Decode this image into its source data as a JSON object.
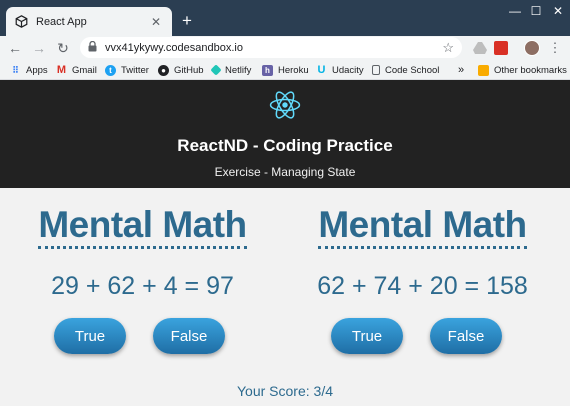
{
  "browser": {
    "tab_title": "React App",
    "url": "vvx41ykywy.codesandbox.io",
    "bookmarks": [
      "Apps",
      "Gmail",
      "Twitter",
      "GitHub",
      "Netlify",
      "Heroku",
      "Udacity",
      "Code School"
    ],
    "overflow": "»",
    "other_bookmarks": "Other bookmarks"
  },
  "header": {
    "title": "ReactND - Coding Practice",
    "subtitle": "Exercise - Managing State"
  },
  "games": [
    {
      "heading": "Mental Math",
      "equation": "29 + 62 + 4 = 97",
      "true_label": "True",
      "false_label": "False"
    },
    {
      "heading": "Mental Math",
      "equation": "62 + 74 + 20 = 158",
      "true_label": "True",
      "false_label": "False"
    }
  ],
  "score": "Your Score: 3/4",
  "colors": {
    "accent": "#2d6a8e",
    "button": "#2a8fcc",
    "header_bg": "#222222",
    "react": "#61dafb"
  },
  "icons": {
    "tab_favicon": "codesandbox-cube-icon",
    "react_logo": "react-atom-icon",
    "lock": "lock-icon",
    "star": "star-icon"
  }
}
